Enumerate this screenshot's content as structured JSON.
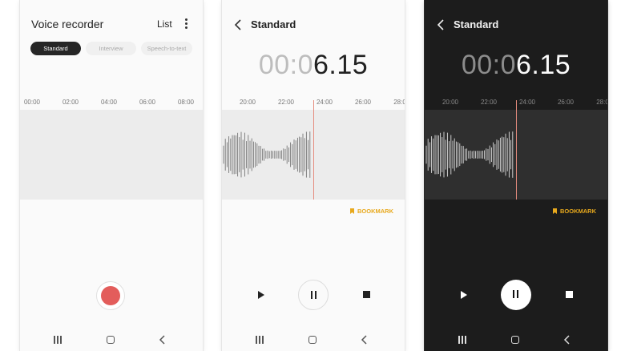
{
  "recorder": {
    "title": "Voice recorder",
    "list_label": "List",
    "modes": [
      "Standard",
      "Interview",
      "Speech-to-text"
    ],
    "active_mode": "Standard",
    "timeline_labels": [
      "00:00",
      "02:00",
      "04:00",
      "06:00",
      "08:00"
    ]
  },
  "recording_light": {
    "title": "Standard",
    "timer_dim": "00:0",
    "timer_lit": "6.15",
    "timeline_labels": [
      "20:00",
      "22:00",
      "24:00",
      "26:00",
      "28:0"
    ],
    "bookmark_label": "BOOKMARK"
  },
  "recording_dark": {
    "title": "Standard",
    "timer_dim": "00:0",
    "timer_lit": "6.15",
    "timeline_labels": [
      "20:00",
      "22:00",
      "24:00",
      "26:00",
      "28:0"
    ],
    "bookmark_label": "BOOKMARK"
  },
  "icons": {
    "more": "more-vertical-icon",
    "back": "chevron-left-icon",
    "bookmark": "bookmark-icon",
    "record": "record-icon",
    "play": "play-icon",
    "pause": "pause-icon",
    "stop": "stop-icon",
    "nav_recents": "recents-icon",
    "nav_home": "home-icon",
    "nav_back": "nav-back-icon"
  },
  "colors": {
    "record": "#e35d5b",
    "bookmark": "#e8a91d",
    "playhead": "#e58c7e",
    "active_mode": "#262626",
    "dark_background": "#1c1c1c"
  }
}
